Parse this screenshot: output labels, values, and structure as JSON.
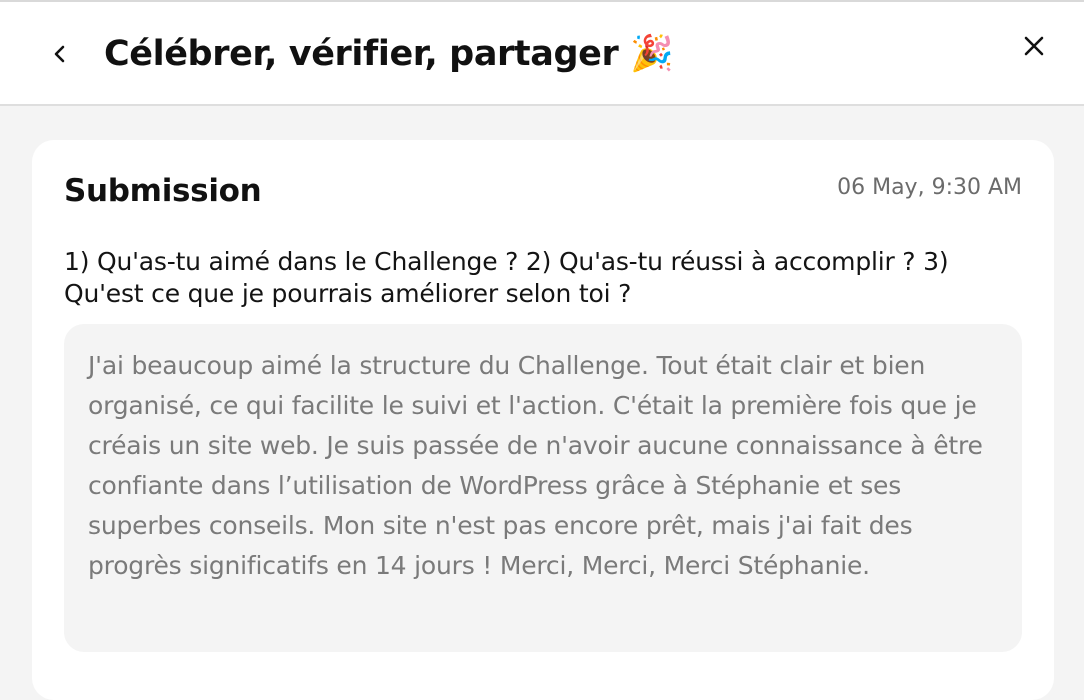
{
  "header": {
    "title": "Célébrer, vérifier, partager 🎉",
    "back_icon": "chevron-left-icon",
    "close_icon": "close-icon"
  },
  "submission": {
    "heading": "Submission",
    "date": "06 May, 9:30 AM",
    "question": "1) Qu'as-tu aimé dans le Challenge ? 2) Qu'as-tu réussi à accomplir ? 3) Qu'est ce que je pourrais améliorer selon toi ?",
    "answer": "J'ai beaucoup aimé la structure du Challenge. Tout était clair et bien organisé, ce qui facilite le suivi et l'action. C'était la première fois que je créais un site web. Je suis passée de n'avoir aucune connaissance à être confiante dans l’utilisation de WordPress grâce à Stéphanie et ses superbes conseils. Mon site n'est pas encore prêt, mais j'ai fait des progrès significatifs en 14 jours ! Merci, Merci, Merci Stéphanie."
  },
  "colors": {
    "page_background": "#f4f4f4",
    "card_background": "#ffffff",
    "answer_background": "#f4f4f4",
    "answer_text": "#7a7a7a",
    "date_text": "#6b6b6b"
  }
}
